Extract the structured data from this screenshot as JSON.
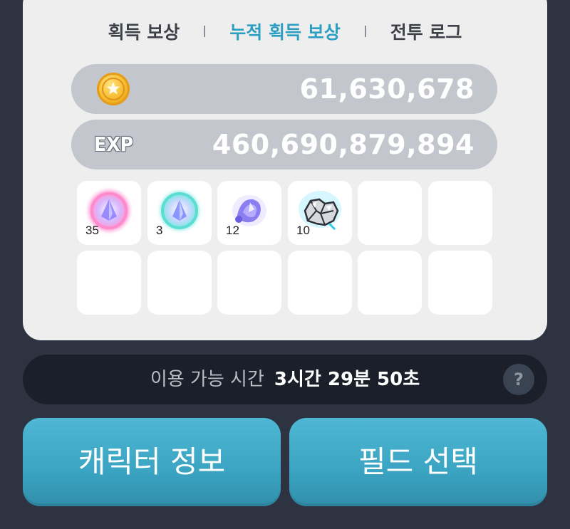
{
  "tabs": [
    {
      "label": "획득 보상",
      "active": false
    },
    {
      "label": "누적 획득 보상",
      "active": true
    },
    {
      "label": "전투 로그",
      "active": false
    }
  ],
  "rewards": {
    "gold": {
      "icon": "gold-coin-icon",
      "value": "61,630,678"
    },
    "exp": {
      "label": "EXP",
      "value": "460,690,879,894"
    }
  },
  "items": [
    {
      "icon": "pink-crystal-orb-icon",
      "count": "35"
    },
    {
      "icon": "cyan-crystal-orb-icon",
      "count": "3"
    },
    {
      "icon": "purple-crystal-icon",
      "count": "12"
    },
    {
      "icon": "silver-ore-icon",
      "count": "10"
    }
  ],
  "time": {
    "label": "이용 가능 시간",
    "value": "3시간 29분 50초",
    "help": "?"
  },
  "buttons": {
    "character_info": "캐릭터 정보",
    "field_select": "필드 선택"
  },
  "colors": {
    "accent": "#2c9fc0",
    "button": "#3aa4c2",
    "background": "#2d3340",
    "panel": "#eeeeee"
  }
}
